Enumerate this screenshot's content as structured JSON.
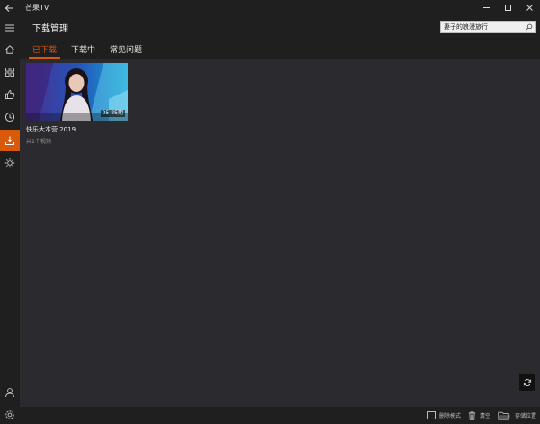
{
  "window": {
    "title": "芒果TV",
    "controls": [
      "minimize",
      "maximize",
      "close"
    ]
  },
  "header": {
    "title": "下载管理",
    "search_value": "妻子的浪漫旅行"
  },
  "tabs": [
    {
      "label": "已下载",
      "active": true
    },
    {
      "label": "下载中",
      "active": false
    },
    {
      "label": "常见问题",
      "active": false
    }
  ],
  "sidebar": {
    "items": [
      {
        "name": "menu-icon"
      },
      {
        "name": "home-icon"
      },
      {
        "name": "apps-icon"
      },
      {
        "name": "thumbs-up-icon"
      },
      {
        "name": "history-icon"
      },
      {
        "name": "download-icon",
        "active": true
      },
      {
        "name": "settings-gear-icon"
      }
    ],
    "bottom_items": [
      {
        "name": "user-icon"
      },
      {
        "name": "gear-icon"
      }
    ]
  },
  "downloads": [
    {
      "title": "快乐大本营 2019",
      "subtitle": "共1个视频",
      "badge": "05-25期"
    }
  ],
  "bottombar": {
    "delete_mode_label": "删除模式",
    "clear_label": "清空",
    "storage_label": "存储位置"
  },
  "colors": {
    "accent": "#d8590a",
    "background": "#2b2b2f",
    "chrome": "#1f1f1f"
  }
}
